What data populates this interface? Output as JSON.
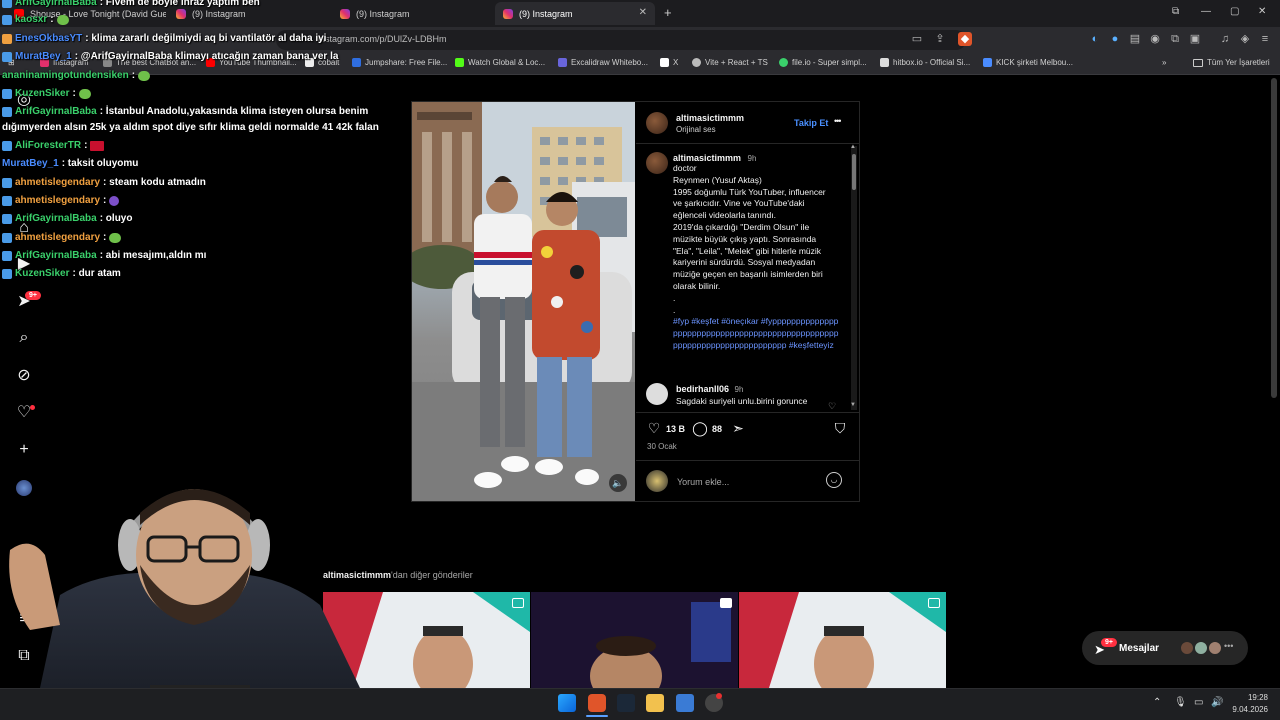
{
  "browser": {
    "tabs": [
      {
        "label": "Shouse - Love Tonight (David Guetta",
        "active": false
      },
      {
        "label": "(9) Instagram",
        "active": false
      },
      {
        "label": "(9) Instagram",
        "active": false
      },
      {
        "label": "(9) Instagram",
        "active": true
      }
    ],
    "new_tab": "+",
    "url": "instagram.com/p/DUlZv-LDBHm",
    "bookmarks": [
      {
        "label": "Instagram",
        "color": "#e1306c"
      },
      {
        "label": "The best ChatBot an...",
        "color": "#888888"
      },
      {
        "label": "YouTube Thumbnail...",
        "color": "#ff0000"
      },
      {
        "label": "cobalt",
        "color": "#eeeeee"
      },
      {
        "label": "Jumpshare: Free File...",
        "color": "#2f6ee0"
      },
      {
        "label": "Watch Global & Loc...",
        "color": "#53fc18"
      },
      {
        "label": "Excalidraw Whitebo...",
        "color": "#6965db"
      },
      {
        "label": "X",
        "color": "#ffffff"
      },
      {
        "label": "Vite + React + TS",
        "color": "#bbbbbb"
      },
      {
        "label": "file.io - Super simpl...",
        "color": "#3ad06b"
      },
      {
        "label": "hitbox.io - Official Si...",
        "color": "#dddddd"
      },
      {
        "label": "KICK şirketi Melbou...",
        "color": "#4a8cff"
      }
    ],
    "all_bookmarks": "Tüm Yer İşaretleri"
  },
  "chat": [
    {
      "user": "ArifGayirnalBaba",
      "msg": ": Fivem de böyle inraz yaptım ben",
      "color": "green"
    },
    {
      "user": "kaosxr",
      "msg": ":",
      "color": "green",
      "emote": "green"
    },
    {
      "user": "EnesOkbasYT",
      "msg": ": klima zararlı değilmiydi aq bi vantilatör al daha iyi",
      "color": "blue"
    },
    {
      "user": "MuratBey_1",
      "msg": ": @ArifGayirnalBaba klimayı atıcağın zaman bana ver la",
      "color": "blue"
    },
    {
      "user": "ananinamingotundensiken",
      "msg": ":",
      "color": "green",
      "emote": "green"
    },
    {
      "user": "KuzenSiker",
      "msg": ":",
      "color": "green",
      "emote": "green"
    },
    {
      "user": "ArifGayirnalBaba",
      "msg": ": İstanbul Anadolu,yakasında klima isteyen olursa benim",
      "color": "green"
    },
    {
      "user": "",
      "msg": "dığımyerden alsın 25k ya aldım spot diye sıfır klima geldi normalde 41 42k falan",
      "color": ""
    },
    {
      "user": "AliForesterTR",
      "msg": ":",
      "color": "green",
      "emote": "red"
    },
    {
      "user": "MuratBey_1",
      "msg": ": taksit oluyomu",
      "color": "blue"
    },
    {
      "user": "ahmetislegendary",
      "msg": ": steam kodu atmadın",
      "color": "orange"
    },
    {
      "user": "ahmetislegendary",
      "msg": ":",
      "color": "orange",
      "emote": "purple"
    },
    {
      "user": "ArifGayirnalBaba",
      "msg": ": oluyo",
      "color": "green"
    },
    {
      "user": "ahmetislegendary",
      "msg": ":",
      "color": "orange",
      "emote": "green"
    },
    {
      "user": "ArifGayirnalBaba",
      "msg": ": abi mesajımı,aldın mı",
      "color": "green"
    },
    {
      "user": "KuzenSiker",
      "msg": ": dur atam",
      "color": "green"
    }
  ],
  "nav": {
    "notifications_badge": "9+"
  },
  "post": {
    "author": "altimasictimmm",
    "audio": "Orijinal ses",
    "follow": "Takip Et",
    "more": "•••",
    "caption_author": "altimasictimmm",
    "caption_time": "9h",
    "caption_lines": [
      "doctor",
      "Reynmen (Yusuf Aktaş)",
      "1995 doğumlu Türk YouTuber, influencer",
      "ve şarkıcıdır. Vine ve YouTube'daki",
      "eğlenceli videolarla tanındı.",
      "2019'da çıkardığı \"Derdim Olsun\" ile",
      "müzikte büyük çıkış yaptı. Sonrasında",
      "\"Ela\", \"Leila\", \"Melek\" gibi hitlerle müzik",
      "kariyerini sürdürdü. Sosyal medyadan",
      "müziğe geçen en başarılı isimlerden biri",
      "olarak bilinir.",
      ".",
      "."
    ],
    "hashtags": "#fyp #keşfet #öneçıkar #fyppppppppppppppppppppppppppppppppppppppppppppppppppppppppppppppppppppppppp #keşfetteyiz",
    "comment_user": "bedirhanll06",
    "comment_time": "9h",
    "comment_text": "Sagdaki suriyeli unlu.birini gorunce",
    "likes": "13 B",
    "comments": "88",
    "date": "30 Ocak",
    "comment_placeholder": "Yorum ekle..."
  },
  "more_posts": {
    "user": "altimasictimmm",
    "suffix": "'dan diğer gönderiler"
  },
  "messages": {
    "label": "Mesajlar",
    "badge": "9+"
  },
  "taskbar": {
    "time": "19:28",
    "date": "9.04.2026"
  }
}
